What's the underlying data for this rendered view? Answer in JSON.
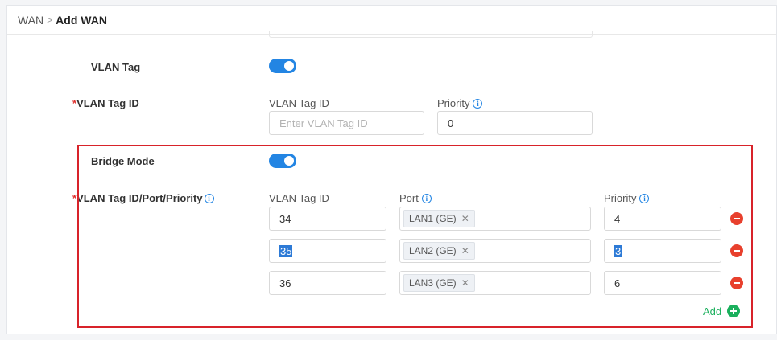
{
  "breadcrumb": {
    "parent": "WAN",
    "separator": ">",
    "current": "Add WAN"
  },
  "vlan_tag": {
    "label": "VLAN Tag",
    "enabled": true
  },
  "vlan_tag_id": {
    "label": "VLAN Tag ID",
    "required_mark": "*",
    "id_label": "VLAN Tag ID",
    "id_placeholder": "Enter VLAN Tag ID",
    "priority_label": "Priority",
    "priority_value": "0"
  },
  "bridge_mode": {
    "label": "Bridge Mode",
    "enabled": true
  },
  "bridge_table": {
    "label": "VLAN Tag ID/Port/Priority",
    "required_mark": "*",
    "col_id": "VLAN Tag ID",
    "col_port": "Port",
    "col_priority": "Priority",
    "rows": [
      {
        "id": "34",
        "port": "LAN1 (GE)",
        "priority": "4"
      },
      {
        "id": "35",
        "port": "LAN2 (GE)",
        "priority": "3"
      },
      {
        "id": "36",
        "port": "LAN3 (GE)",
        "priority": "6"
      }
    ],
    "add_label": "Add"
  },
  "icons": {
    "info": "info-icon",
    "remove": "minus-circle-icon",
    "add": "plus-circle-icon",
    "tag_remove": "close-icon"
  },
  "colors": {
    "accent": "#2385e3",
    "required": "#e0312f",
    "remove": "#e8402d",
    "add": "#1bb05d",
    "highlight_box": "#d8232a"
  }
}
